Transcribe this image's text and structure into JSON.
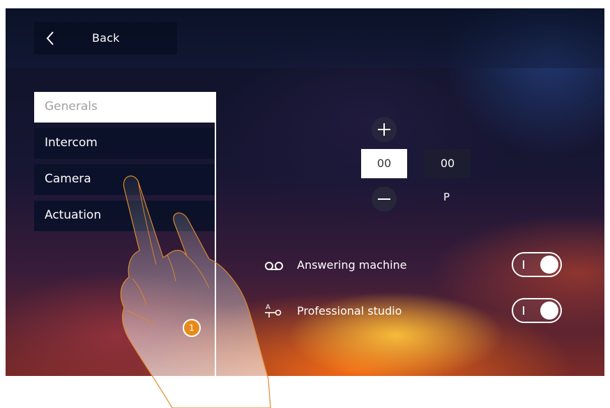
{
  "header": {
    "back_label": "Back"
  },
  "menu": {
    "items": [
      {
        "label": "Generals",
        "active": true
      },
      {
        "label": "Intercom",
        "active": false
      },
      {
        "label": "Camera",
        "active": false
      },
      {
        "label": "Actuation",
        "active": false
      }
    ]
  },
  "address": {
    "left_value": "00",
    "right_value": "00",
    "right_caption": "P"
  },
  "options": [
    {
      "label": "Answering machine",
      "icon": "voicemail-icon",
      "enabled": true
    },
    {
      "label": "Professional studio",
      "icon": "professional-studio-icon",
      "enabled": true
    }
  ],
  "annotation": {
    "step_number": "1"
  },
  "colors": {
    "accent_orange": "#e88a1a",
    "panel_dark": "#0a1228",
    "active_item_bg": "#ffffff"
  }
}
